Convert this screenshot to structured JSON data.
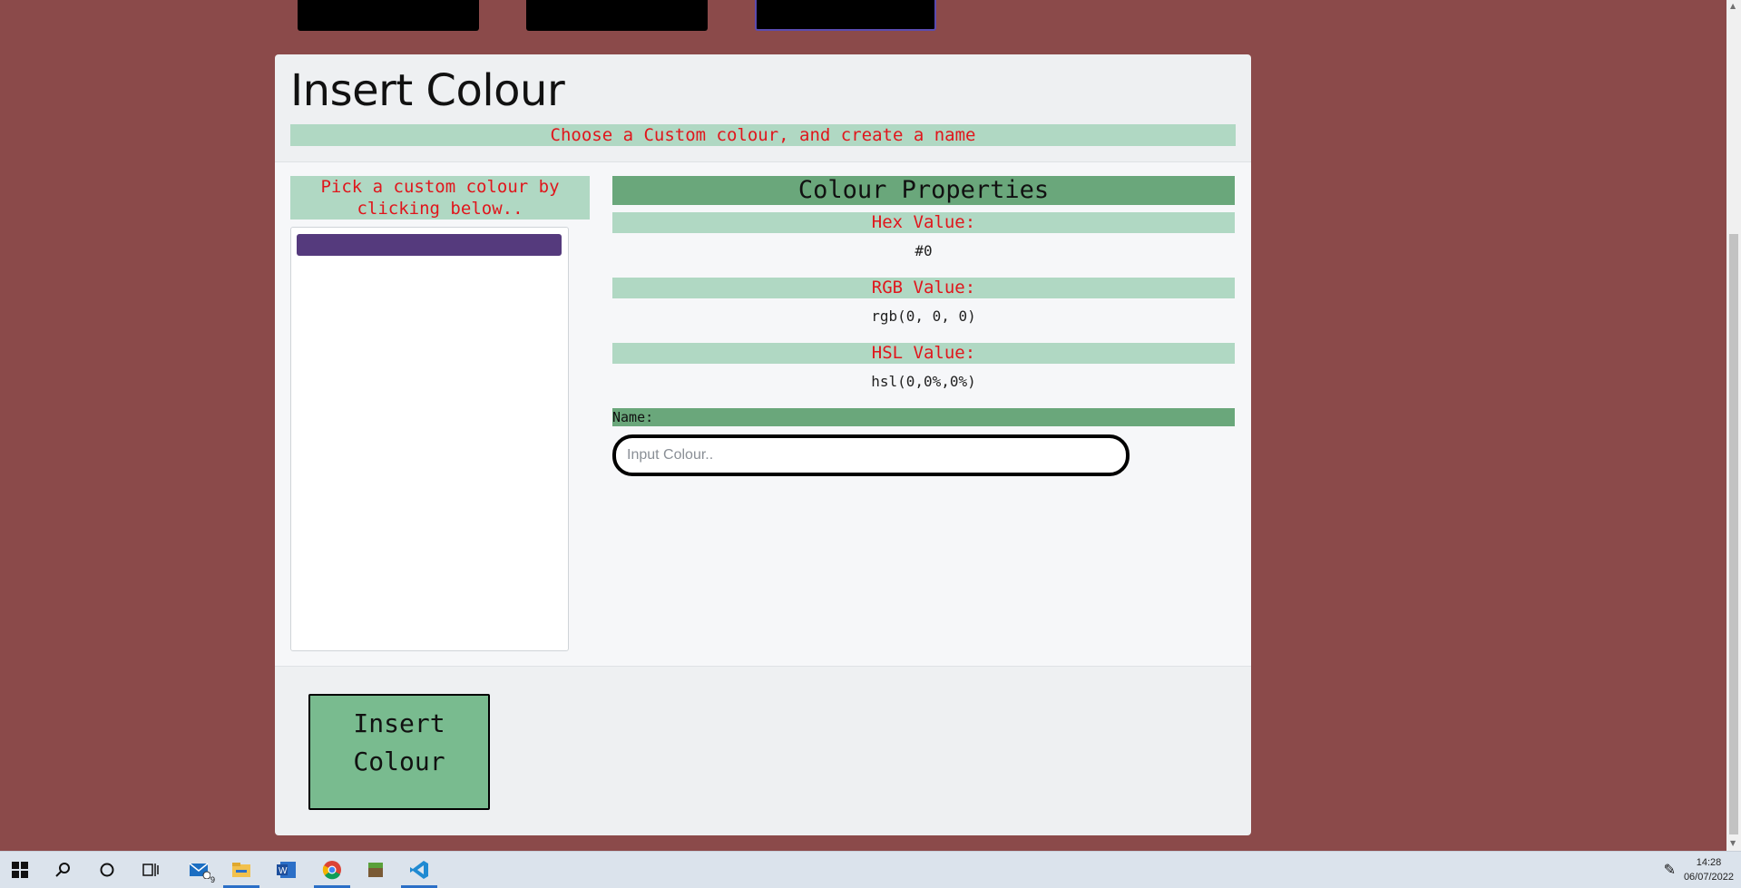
{
  "header": {
    "title": "Insert Colour",
    "subtitle": "Choose a Custom colour, and create a name"
  },
  "picker": {
    "label": "Pick a custom colour by clicking below..",
    "swatches": [
      {
        "color": "#553a7d"
      }
    ]
  },
  "properties": {
    "title": "Colour Properties",
    "hex_label": "Hex Value:",
    "hex_value": "#0",
    "rgb_label": "RGB Value:",
    "rgb_value": "rgb(0, 0, 0)",
    "hsl_label": "HSL Value:",
    "hsl_value": "hsl(0,0%,0%)",
    "name_label": "Name:",
    "name_placeholder": "Input Colour..",
    "name_value": ""
  },
  "footer": {
    "insert_button": "Insert Colour"
  },
  "taskbar": {
    "time": "14:28",
    "date": "06/07/2022",
    "mail_badge": "9",
    "icons": [
      "windows-start-icon",
      "search-icon",
      "cortana-icon",
      "task-view-icon",
      "mail-icon",
      "file-explorer-icon",
      "word-icon",
      "chrome-icon",
      "minecraft-icon",
      "vscode-icon",
      "pen-icon"
    ]
  },
  "colors": {
    "background": "#8b4a4a",
    "panel": "#eef0f2",
    "label_bg": "#b0d8c3",
    "label_text": "#e0161c",
    "accent_green": "#6aa77b",
    "button_green": "#79bb8f"
  }
}
